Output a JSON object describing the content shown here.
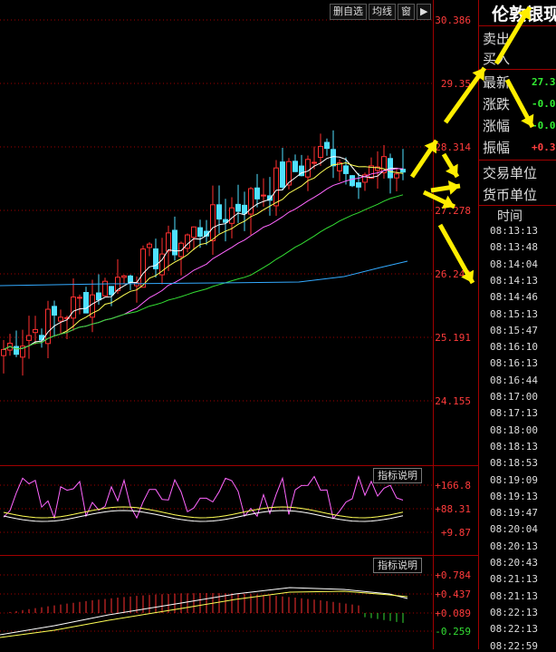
{
  "toolbar": {
    "delete_self": "删自选",
    "ma": "均线",
    "window": "窗",
    "next": "▶"
  },
  "price_axis": [
    "30.386",
    "29.35",
    "28.314",
    "27.278",
    "26.242",
    "25.191",
    "24.155"
  ],
  "indicator1": {
    "label": "指标说明",
    "axis": [
      "+166.8",
      "+88.31",
      "+9.87"
    ]
  },
  "indicator2": {
    "label": "指标说明",
    "axis": [
      "+0.784",
      "+0.437",
      "+0.089",
      "-0.259"
    ]
  },
  "panel": {
    "title": "伦敦银现",
    "sell": "卖出",
    "buy": "买入",
    "latest_label": "最新",
    "latest_value": "27.3",
    "change_label": "涨跌",
    "change_value": "-0.0",
    "pct_label": "涨幅",
    "pct_value": "-0.0",
    "amp_label": "振幅",
    "amp_value": "+0.3",
    "trade_unit": "交易单位",
    "currency_unit": "货币单位",
    "time_header": "时间",
    "times": [
      "08:13:13",
      "08:13:48",
      "08:14:04",
      "08:14:13",
      "08:14:46",
      "08:15:13",
      "08:15:47",
      "08:16:10",
      "08:16:13",
      "08:16:44",
      "08:17:00",
      "08:17:13",
      "08:18:00",
      "08:18:13",
      "08:18:53",
      "08:19:09",
      "08:19:13",
      "08:19:47",
      "08:20:04",
      "08:20:13",
      "08:20:43",
      "08:21:13",
      "08:21:13",
      "08:22:13",
      "08:22:13",
      "08:22:59"
    ]
  },
  "colors": {
    "up": "#ff3030",
    "down": "#4fe0ff",
    "grid": "#a00000",
    "ma5": "#ffffff",
    "ma10": "#ffff55",
    "ma20": "#ff66ff",
    "ma40": "#33dd33",
    "ma60": "#33aaff",
    "arrow": "#ffee00"
  }
}
